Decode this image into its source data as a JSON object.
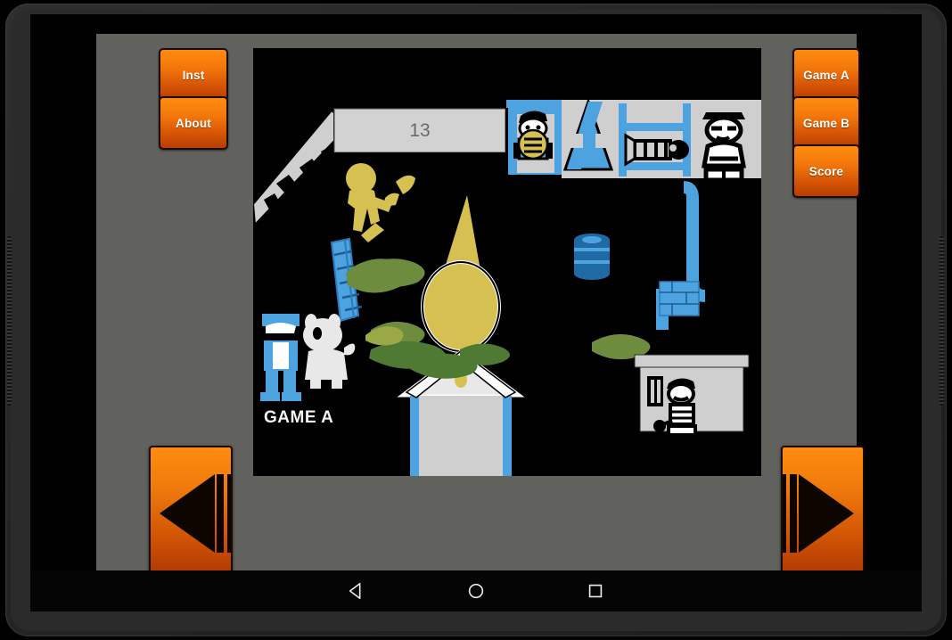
{
  "app": {
    "title": "Game A",
    "background_color": "#61615d",
    "accent_color": "#f4780b"
  },
  "left_buttons": [
    {
      "id": "inst",
      "label": "Inst",
      "icon": "instructions-button"
    },
    {
      "id": "about",
      "label": "About",
      "icon": "about-button"
    }
  ],
  "right_buttons": [
    {
      "id": "game_a",
      "label": "Game A",
      "icon": "game-a-button"
    },
    {
      "id": "game_b",
      "label": "Game B",
      "icon": "game-b-button"
    },
    {
      "id": "score",
      "label": "Score",
      "icon": "score-button"
    }
  ],
  "nav_buttons": [
    {
      "id": "prev",
      "label": "Previous",
      "icon": "skip-previous-icon"
    },
    {
      "id": "next",
      "label": "Next",
      "icon": "skip-next-icon"
    }
  ],
  "scene": {
    "score_value": "13",
    "mode_label": "GAME A",
    "canvas_background": "#000000",
    "palette": {
      "blue": "#4da2e0",
      "yellow": "#d6c052",
      "grey": "#cfcfcf",
      "green_dark": "#4e7a33",
      "green_light": "#9aa847",
      "black": "#000000",
      "white": "#ffffff"
    },
    "elements": [
      {
        "name": "score-panel",
        "value": "13"
      },
      {
        "name": "rubble-ramp"
      },
      {
        "name": "yellow-walking-figure"
      },
      {
        "name": "blue-doorway-with-figure"
      },
      {
        "name": "blue-house-roof"
      },
      {
        "name": "blue-bunk-bed-with-sleeper"
      },
      {
        "name": "standing-worker-figure"
      },
      {
        "name": "lighthouse-beam"
      },
      {
        "name": "lighthouse-lamp"
      },
      {
        "name": "lighthouse-tower"
      },
      {
        "name": "blue-barrel"
      },
      {
        "name": "blue-pipe-and-brick-wall"
      },
      {
        "name": "blue-ladder"
      },
      {
        "name": "person-with-dog"
      },
      {
        "name": "green-bushes"
      },
      {
        "name": "grey-shed-with-figure"
      }
    ]
  },
  "system_nav": [
    {
      "id": "back",
      "label": "Back",
      "icon": "back-triangle-icon"
    },
    {
      "id": "home",
      "label": "Home",
      "icon": "home-circle-icon"
    },
    {
      "id": "recent",
      "label": "Recent apps",
      "icon": "recents-square-icon"
    }
  ]
}
